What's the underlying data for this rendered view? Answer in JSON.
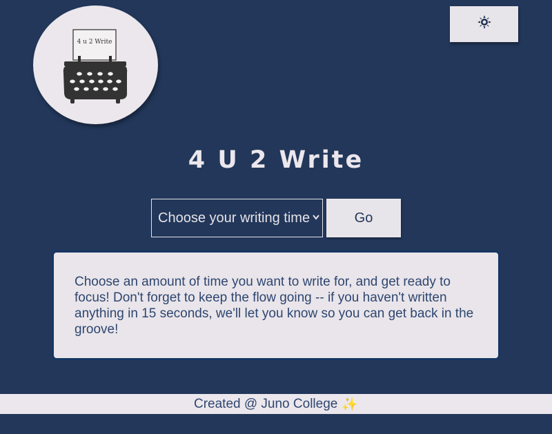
{
  "header": {
    "logo_text": "4 u 2 Write",
    "theme_toggle_icon": "sun-icon"
  },
  "main": {
    "title": "4 U 2 Write",
    "time_select": {
      "selected": "Choose your writing time",
      "dropdown_icon": "chevron-down-icon"
    },
    "go_label": "Go",
    "instructions": "Choose an amount of time you want to write for, and get ready to focus! Don't forget to keep the flow going -- if you haven't written anything in 15 seconds, we'll let you know so you can get back in the groove!"
  },
  "footer": {
    "credit": "Created @ Juno College",
    "sparkle_icon": "✨"
  },
  "colors": {
    "background": "#22375a",
    "surface": "#ebe7ec",
    "text_dark": "#2e4670",
    "border": "#163763",
    "sparkle": "#f2c21b"
  }
}
